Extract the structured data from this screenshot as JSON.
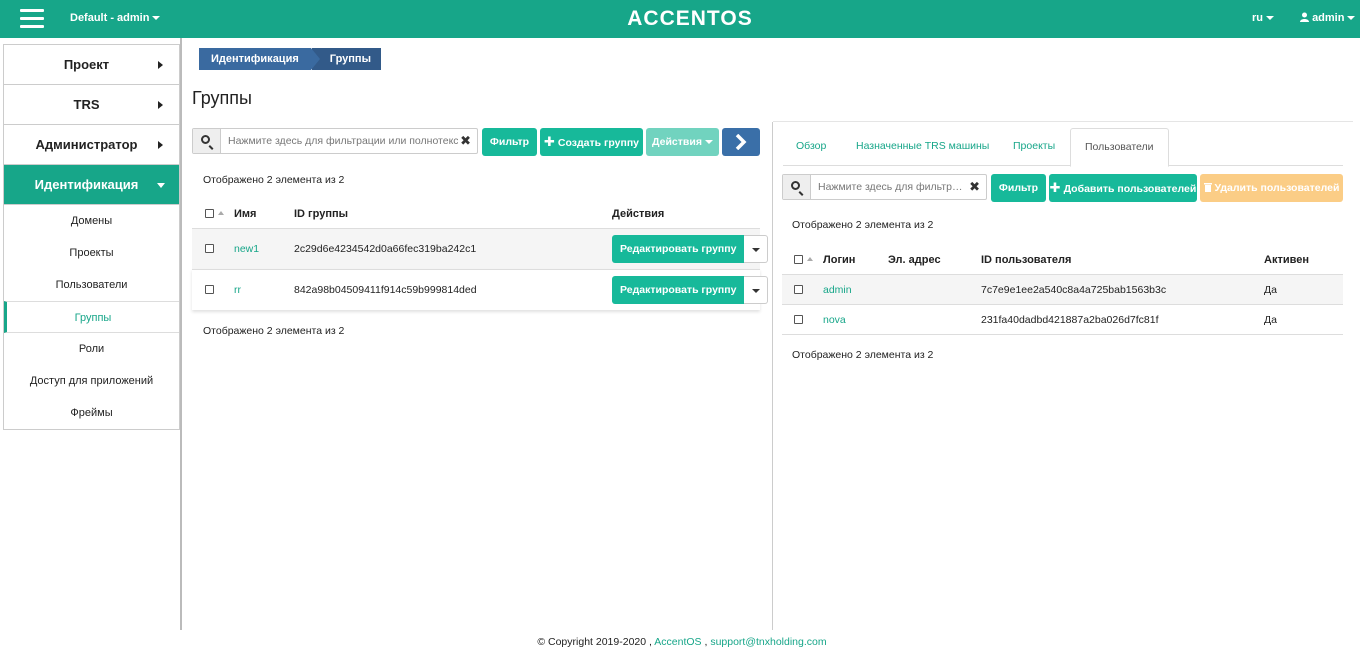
{
  "topbar": {
    "project": "Default - admin",
    "logo": "ACCENTOS",
    "lang": "ru",
    "user": "admin"
  },
  "sidebar": {
    "main": [
      {
        "label": "Проект"
      },
      {
        "label": "TRS"
      },
      {
        "label": "Администратор"
      },
      {
        "label": "Идентификация"
      }
    ],
    "sub": [
      {
        "label": "Домены"
      },
      {
        "label": "Проекты"
      },
      {
        "label": "Пользователи"
      },
      {
        "label": "Группы"
      },
      {
        "label": "Роли"
      },
      {
        "label": "Доступ для приложений"
      },
      {
        "label": "Фреймы"
      }
    ]
  },
  "breadcrumb": {
    "first": "Идентификация",
    "second": "Группы"
  },
  "page_title": "Группы",
  "groups": {
    "search_placeholder": "Нажмите здесь для фильтрации или полнотекстового поиска.",
    "filter_btn": "Фильтр",
    "create_btn": "Создать группу",
    "actions_btn": "Действия",
    "count_text": "Отображено 2 элемента из 2",
    "headers": {
      "name": "Имя",
      "id": "ID группы",
      "actions": "Действия"
    },
    "rows": [
      {
        "name": "new1",
        "id": "2c29d6e4234542d0a66fec319ba242c1",
        "action": "Редактировать группу"
      },
      {
        "name": "rr",
        "id": "842a98b04509411f914c59b999814ded",
        "action": "Редактировать группу"
      }
    ]
  },
  "detail": {
    "tabs": [
      {
        "label": "Обзор"
      },
      {
        "label": "Назначенные TRS машины"
      },
      {
        "label": "Проекты"
      },
      {
        "label": "Пользователи"
      }
    ],
    "search_placeholder": "Нажмите здесь для фильтрации или полнотекстового поиска.",
    "filter_btn": "Фильтр",
    "add_btn": "Добавить пользователей",
    "delete_btn": "Удалить пользователей",
    "count_text": "Отображено 2 элемента из 2",
    "headers": {
      "login": "Логин",
      "email": "Эл. адрес",
      "id": "ID пользователя",
      "active": "Активен"
    },
    "rows": [
      {
        "login": "admin",
        "email": "",
        "id": "7c7e9e1ee2a540c8a4a725bab1563b3c",
        "active": "Да"
      },
      {
        "login": "nova",
        "email": "",
        "id": "231fa40dadbd421887a2ba026d7fc81f",
        "active": "Да"
      }
    ]
  },
  "footer": {
    "copyright": "© Copyright 2019-2020 ,",
    "brand": "AccentOS",
    "sep": ",",
    "email": "support@tnxholding.com"
  },
  "colors": {
    "accent": "#17a689",
    "button": "#17b99a",
    "breadcrumb": "#3a6aa0",
    "warning": "#fbcd86"
  }
}
